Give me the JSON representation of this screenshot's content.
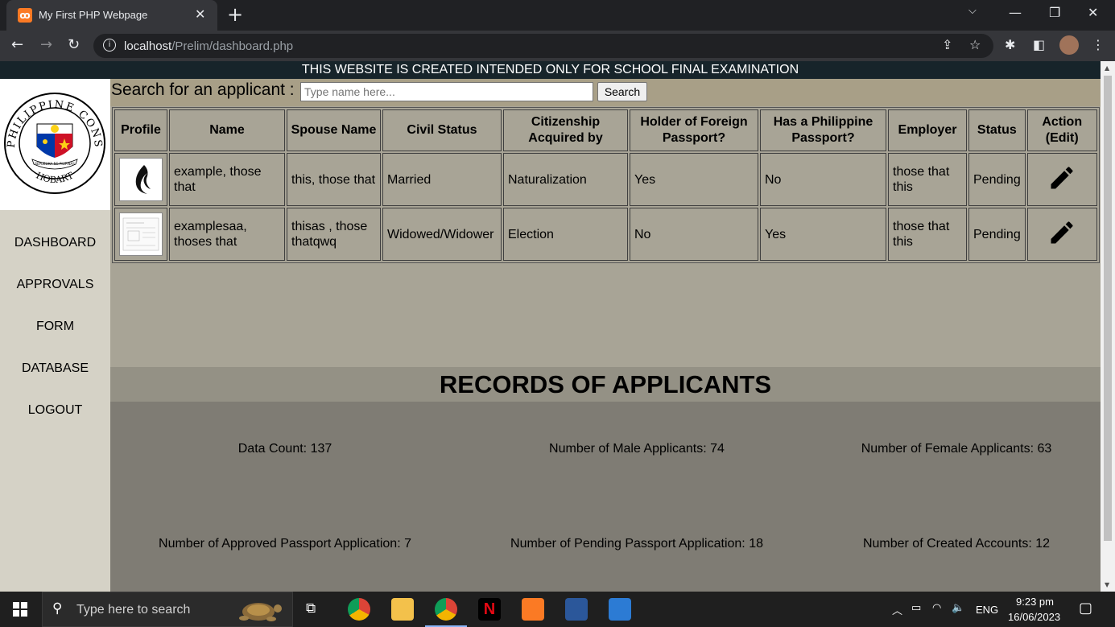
{
  "browser": {
    "tab_title": "My First PHP Webpage",
    "url_host": "localhost",
    "url_path": "/Prelim/dashboard.php"
  },
  "banner": "THIS WEBSITE IS CREATED INTENDED ONLY FOR SCHOOL FINAL EXAMINATION",
  "logo": {
    "ring_text": "PHILIPPINE CONSULATE",
    "bottom_text": "HOBART",
    "ribbon_text": "REPUBLIKA NG PILIPINAS"
  },
  "sidebar": {
    "items": [
      {
        "label": "DASHBOARD"
      },
      {
        "label": "APPROVALS"
      },
      {
        "label": "FORM"
      },
      {
        "label": "DATABASE"
      },
      {
        "label": "LOGOUT"
      }
    ]
  },
  "search": {
    "label": "Search for an applicant :",
    "placeholder": "Type name here...",
    "button": "Search"
  },
  "table": {
    "headers": [
      "Profile",
      "Name",
      "Spouse Name",
      "Civil Status",
      "Citizenship Acquired by",
      "Holder of Foreign Passport?",
      "Has a Philippine Passport?",
      "Employer",
      "Status",
      "Action (Edit)"
    ],
    "rows": [
      {
        "name": "example, those that",
        "spouse": "this, those that",
        "civil_status": "Married",
        "citizenship": "Naturalization",
        "foreign_passport": "Yes",
        "ph_passport": "No",
        "employer": "those that this",
        "status": "Pending"
      },
      {
        "name": "examplesaa, thoses that",
        "spouse": "thisas , those thatqwq",
        "civil_status": "Widowed/Widower",
        "citizenship": "Election",
        "foreign_passport": "No",
        "ph_passport": "Yes",
        "employer": "those that this",
        "status": "Pending"
      }
    ]
  },
  "records": {
    "title": "RECORDS OF APPLICANTS",
    "stats": [
      "Data Count: 137",
      "Number of Male Applicants: 74",
      "Number of Female Applicants: 63",
      "Number of Approved Passport Application: 7",
      "Number of Pending Passport Application: 18",
      "Number of Created Accounts: 12"
    ]
  },
  "taskbar": {
    "search_placeholder": "Type here to search",
    "language": "ENG",
    "time": "9:23 pm",
    "date": "16/06/2023"
  }
}
